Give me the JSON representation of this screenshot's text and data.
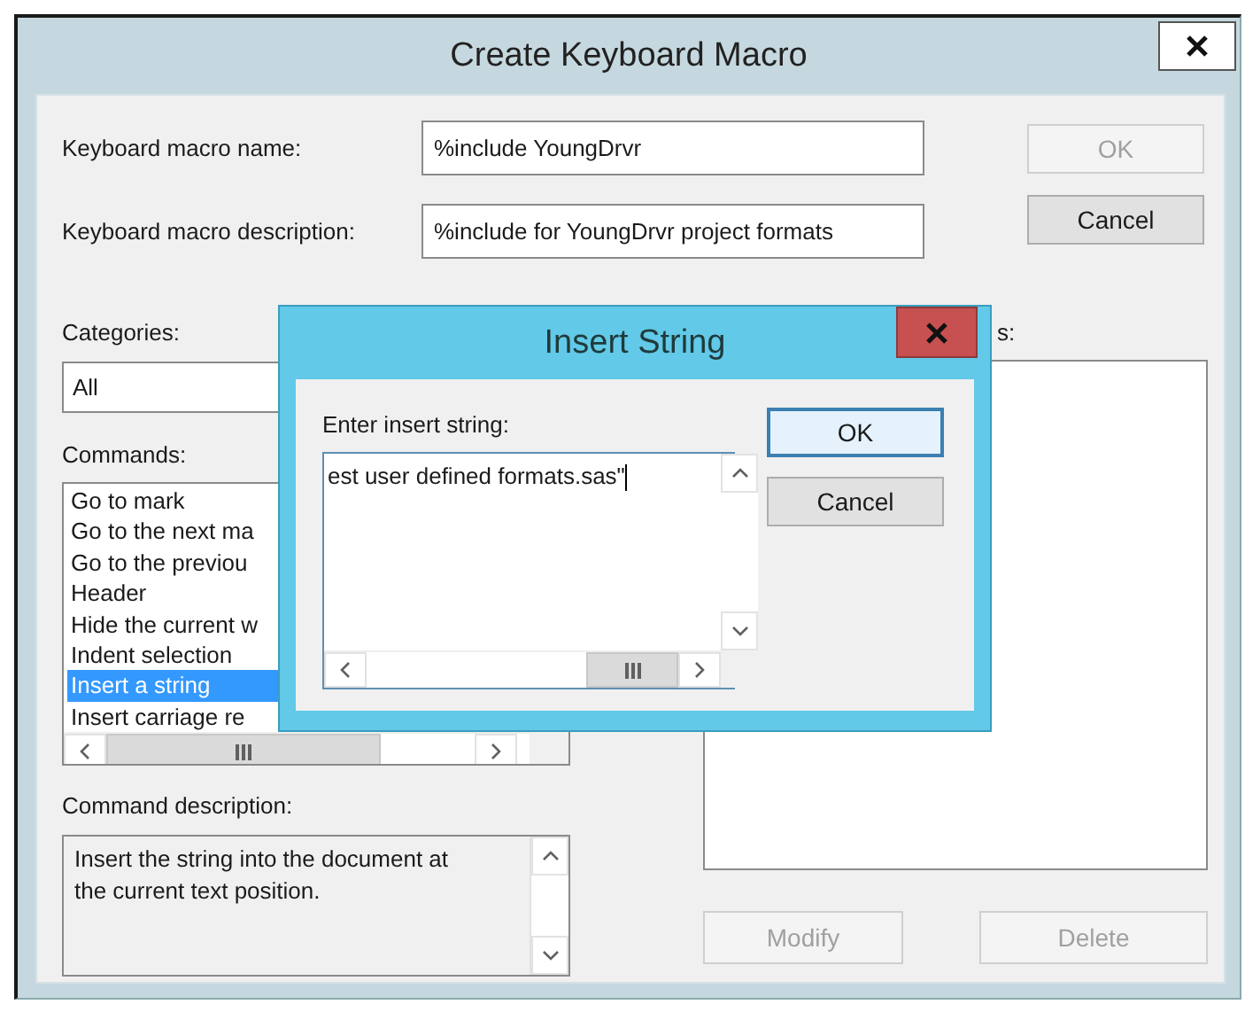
{
  "window": {
    "title": "Create Keyboard Macro"
  },
  "fields": [
    {
      "label": "Keyboard macro name:",
      "value": "%include YoungDrvr"
    },
    {
      "label": "Keyboard macro description:",
      "value": "%include for YoungDrvr project formats"
    }
  ],
  "buttons": [
    {
      "label": "OK",
      "disabled": true
    },
    {
      "label": "Cancel",
      "disabled": false
    }
  ],
  "categories": {
    "label": "Categories:",
    "value": "All"
  },
  "commands": {
    "label": "Commands:",
    "items": [
      {
        "text": "Go to mark",
        "selected": false
      },
      {
        "text": "Go to the next ma",
        "selected": false
      },
      {
        "text": "Go to the previou",
        "selected": false
      },
      {
        "text": "Header",
        "selected": false
      },
      {
        "text": "Hide the current w",
        "selected": false
      },
      {
        "text": "Indent selection",
        "selected": false
      },
      {
        "text": "Insert a string",
        "selected": true
      },
      {
        "text": "Insert carriage re",
        "selected": false
      }
    ]
  },
  "command_description": {
    "label": "Command description:",
    "text": "Insert the string into the document at the current text position."
  },
  "right_panel": {
    "label": "s:",
    "buttons": [
      {
        "label": "Modify",
        "disabled": true
      },
      {
        "label": "Delete",
        "disabled": true
      }
    ]
  },
  "dialog": {
    "title": "Insert String",
    "label": "Enter insert string:",
    "value": "est user defined formats.sas\"",
    "buttons": [
      {
        "label": "OK",
        "default": true
      },
      {
        "label": "Cancel",
        "default": false
      }
    ]
  }
}
